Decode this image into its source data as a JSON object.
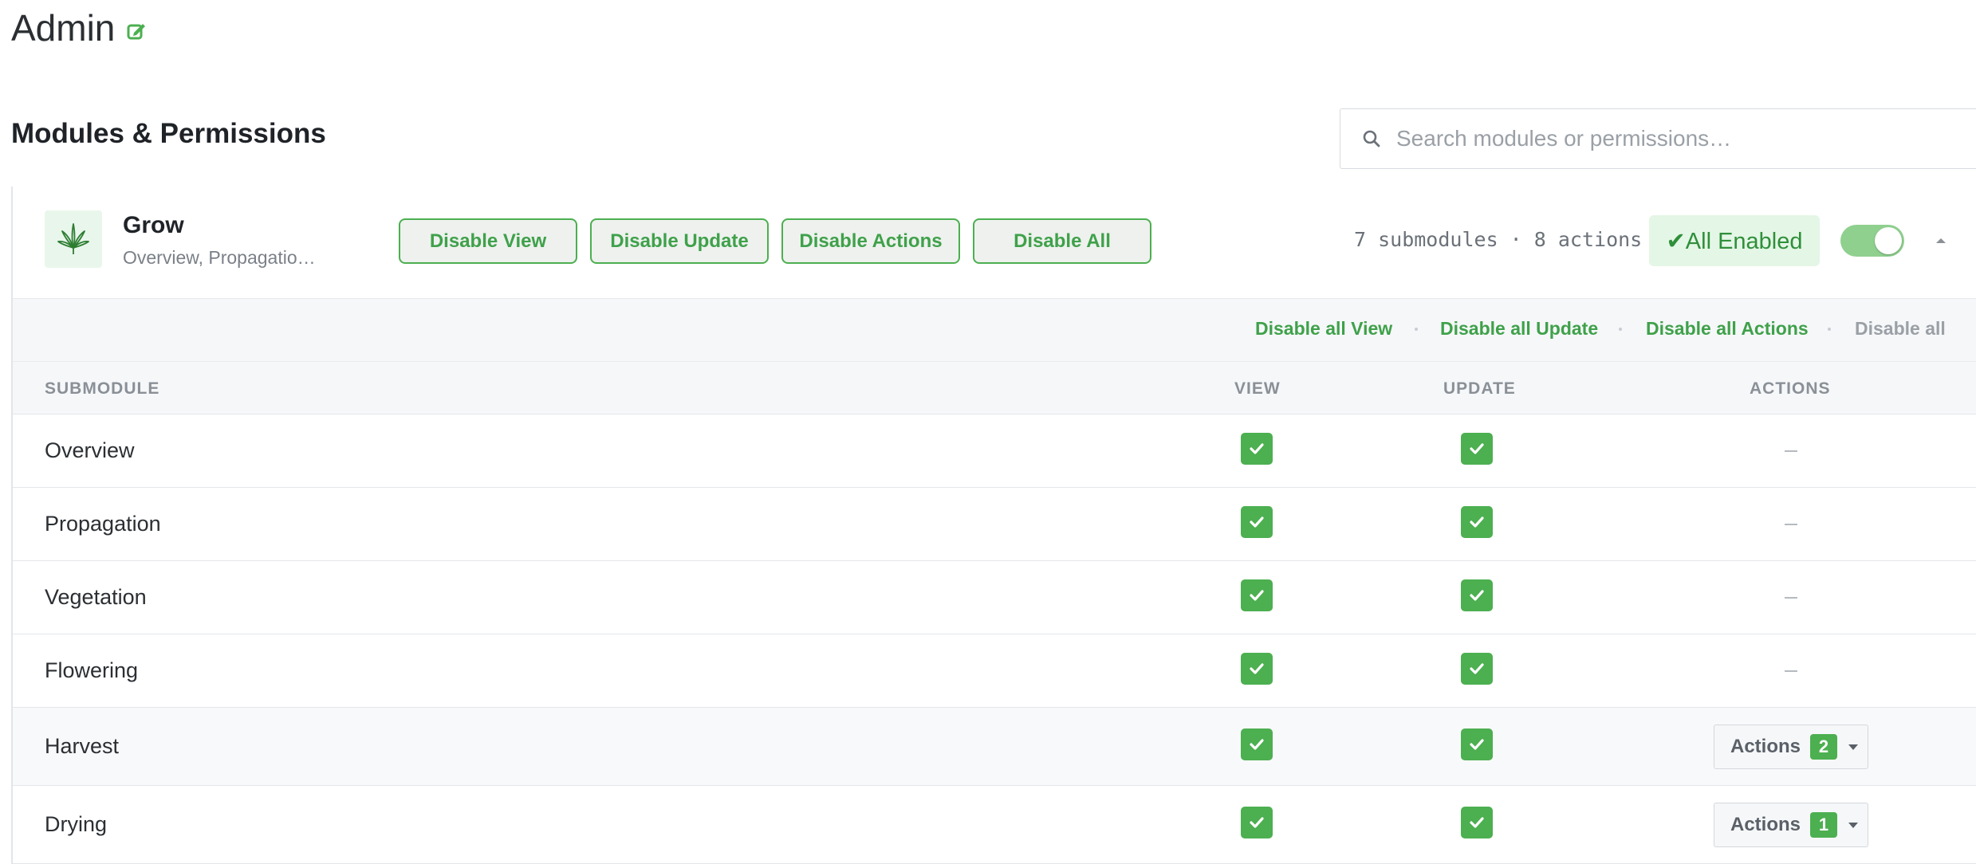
{
  "page": {
    "title": "Admin",
    "section_title": "Modules & Permissions"
  },
  "search": {
    "placeholder": "Search modules or permissions…",
    "value": ""
  },
  "module": {
    "name": "Grow",
    "subtitle": "Overview, Propagatio…",
    "buttons": {
      "disable_view": "Disable View",
      "disable_update": "Disable Update",
      "disable_actions": "Disable Actions",
      "disable_all": "Disable All"
    },
    "counts": "7 submodules · 8 actions",
    "status": "✔All Enabled",
    "toggle_on": true
  },
  "bulk": {
    "disable_all_view": "Disable all View",
    "disable_all_update": "Disable all Update",
    "disable_all_actions": "Disable all Actions",
    "disable_all": "Disable all"
  },
  "table": {
    "columns": {
      "submodule": "SUBMODULE",
      "view": "VIEW",
      "update": "UPDATE",
      "actions": "ACTIONS"
    },
    "rows": [
      {
        "name": "Overview",
        "view": true,
        "update": true,
        "actions": "–"
      },
      {
        "name": "Propagation",
        "view": true,
        "update": true,
        "actions": "–"
      },
      {
        "name": "Vegetation",
        "view": true,
        "update": true,
        "actions": "–"
      },
      {
        "name": "Flowering",
        "view": true,
        "update": true,
        "actions": "–"
      },
      {
        "name": "Harvest",
        "view": true,
        "update": true,
        "actions_label": "Actions",
        "actions_count": "2"
      },
      {
        "name": "Drying",
        "view": true,
        "update": true,
        "actions_label": "Actions",
        "actions_count": "1"
      }
    ]
  },
  "colors": {
    "accent": "#4caf50",
    "accent_text": "#3fa14a",
    "status_bg": "#e4f6e6",
    "toggle_bg": "#8fd08f"
  },
  "icons": {
    "edit": "edit-icon",
    "search": "search-icon",
    "module": "cannabis-leaf-icon",
    "collapse": "chevron-up-icon",
    "check": "check-icon"
  }
}
